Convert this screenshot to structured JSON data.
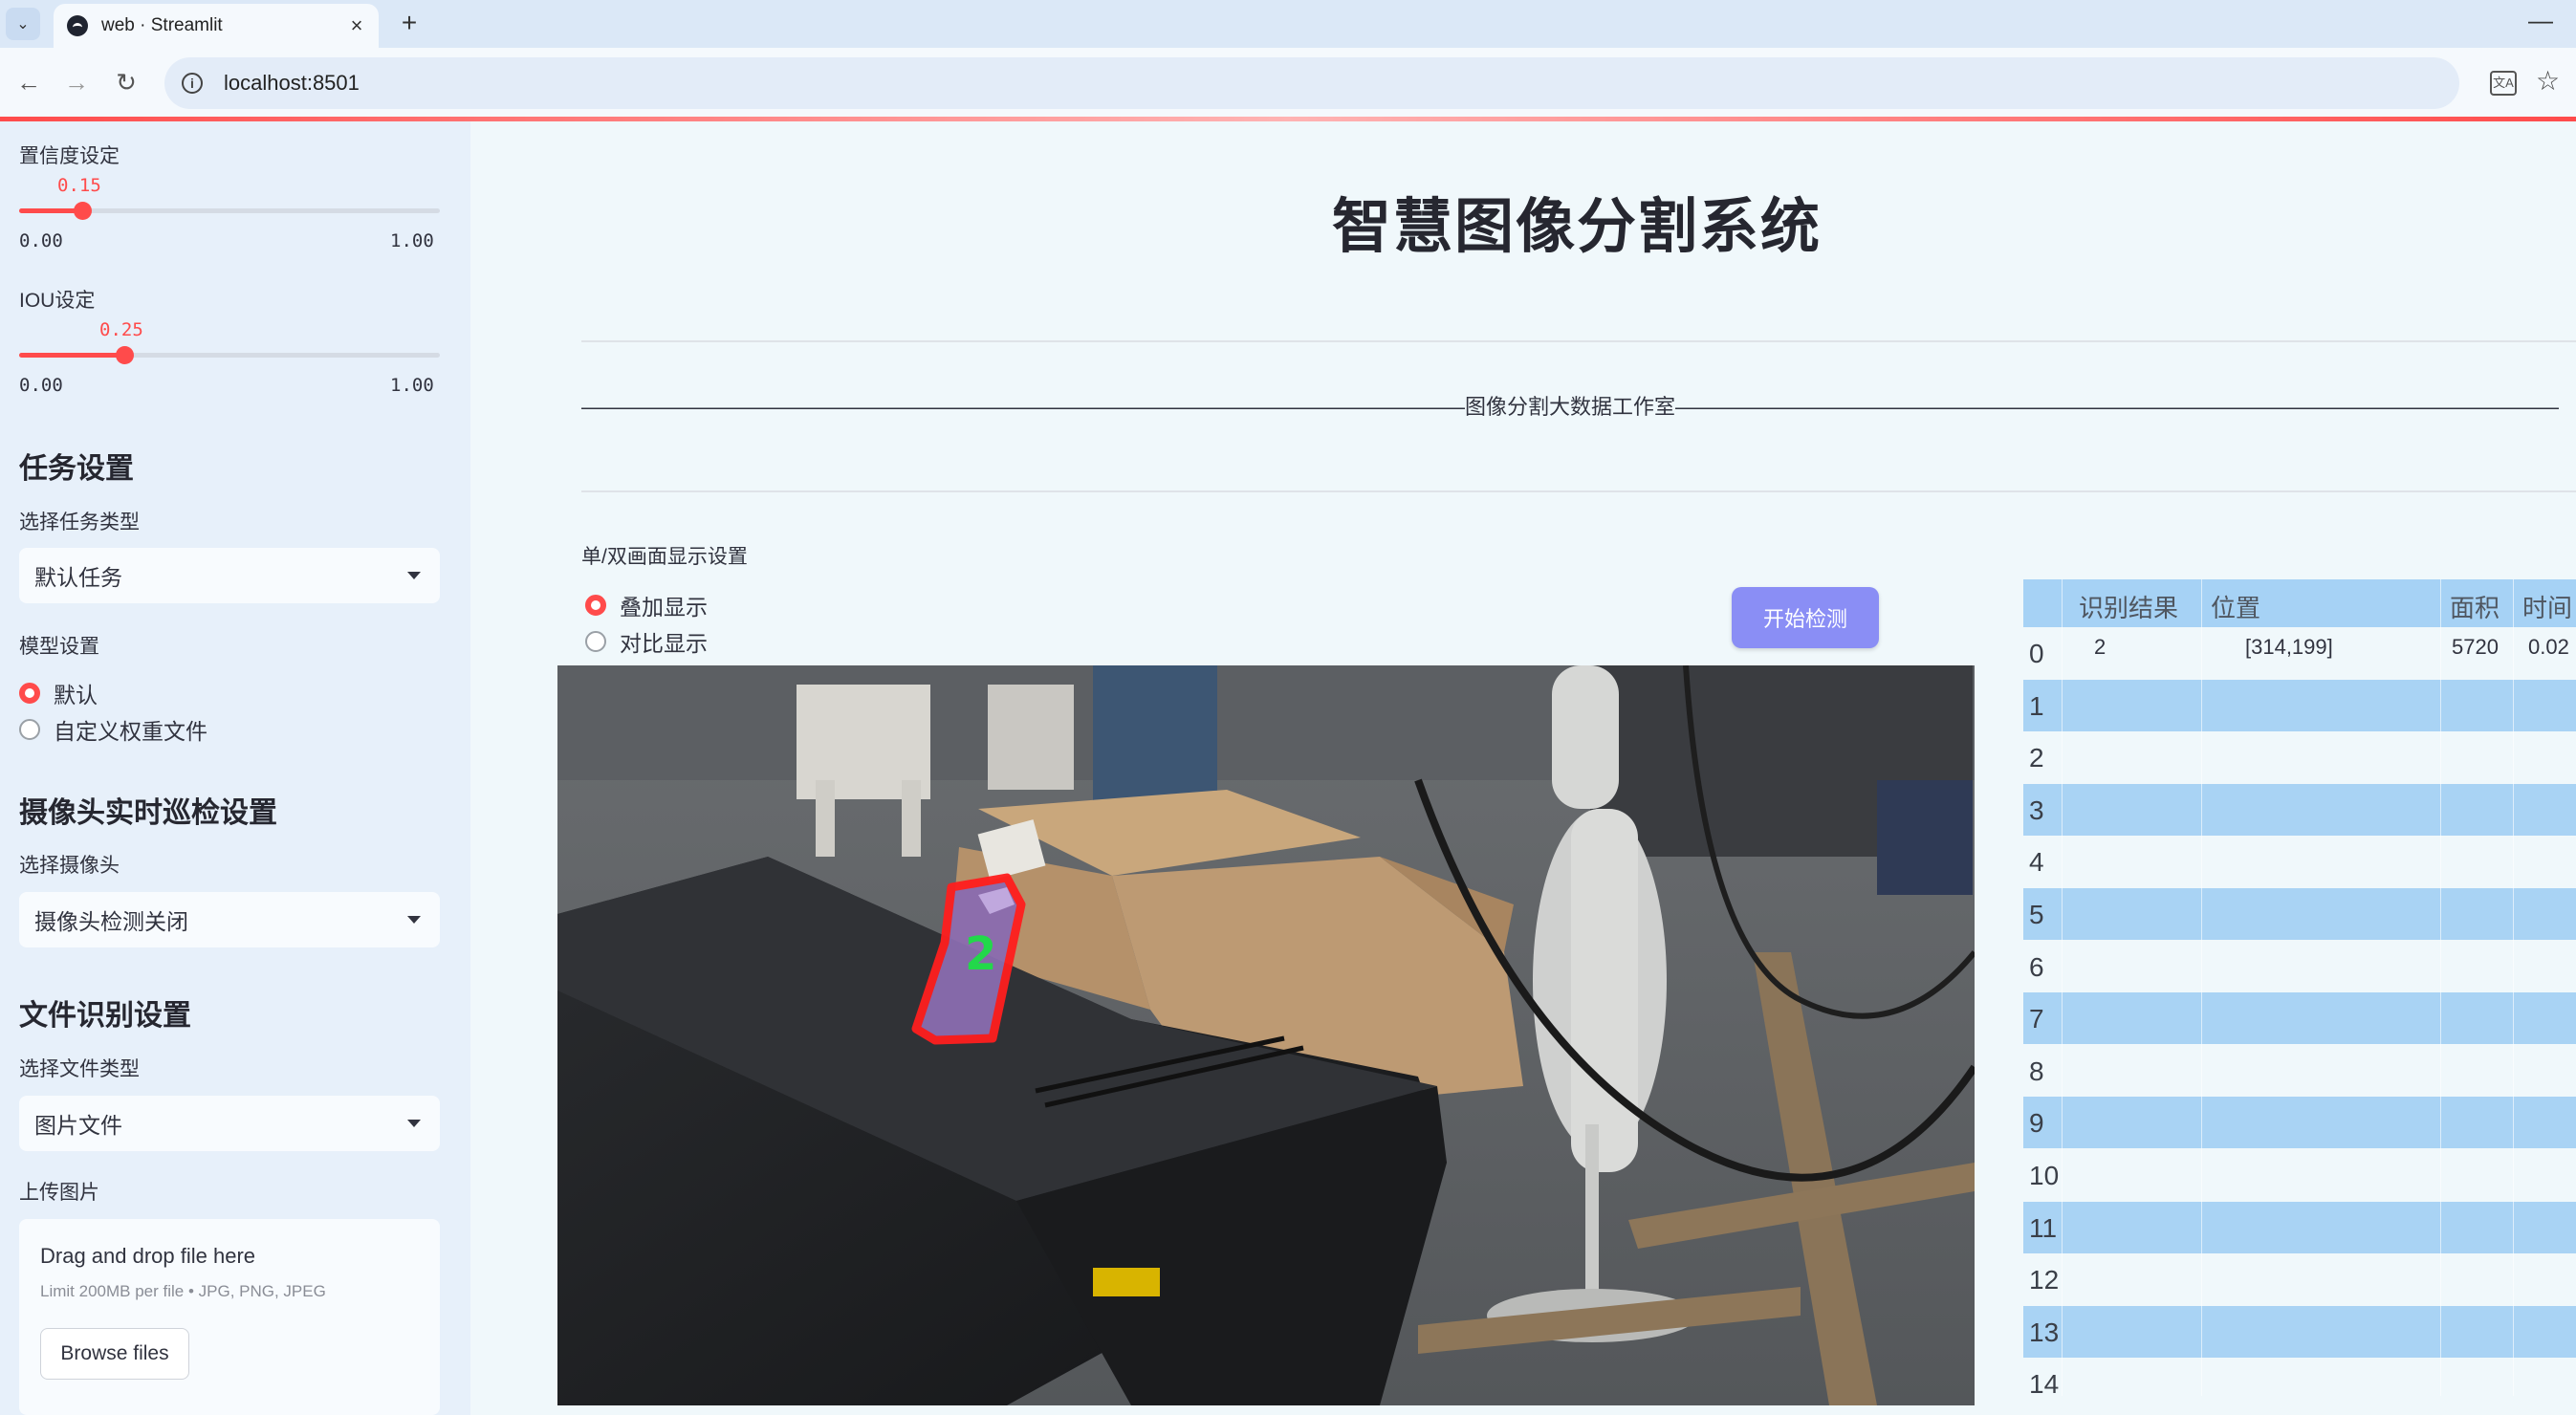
{
  "browser": {
    "tab_title": "web · Streamlit",
    "url": "localhost:8501",
    "new_tab": "+",
    "close_tab": "×",
    "minimize": "—"
  },
  "sidebar": {
    "confidence": {
      "label": "置信度设定",
      "value": "0.15",
      "value_fraction": 0.15,
      "min": "0.00",
      "max": "1.00"
    },
    "iou": {
      "label": "IOU设定",
      "value": "0.25",
      "value_fraction": 0.25,
      "min": "0.00",
      "max": "1.00"
    },
    "task_heading": "任务设置",
    "task_type_label": "选择任务类型",
    "task_type_value": "默认任务",
    "model_label": "模型设置",
    "model_options": [
      "默认",
      "自定义权重文件"
    ],
    "model_selected": 0,
    "camera_heading": "摄像头实时巡检设置",
    "camera_label": "选择摄像头",
    "camera_value": "摄像头检测关闭",
    "file_heading": "文件识别设置",
    "file_type_label": "选择文件类型",
    "file_type_value": "图片文件",
    "upload_label": "上传图片",
    "upload_title": "Drag and drop file here",
    "upload_limit": "Limit 200MB per file • JPG, PNG, JPEG",
    "browse_button": "Browse files"
  },
  "main": {
    "title": "智慧图像分割系统",
    "studio_line": "——————————————————————————————————————————图像分割大数据工作室——————————————————————————————————————————",
    "display_mode_label": "单/双画面显示设置",
    "display_options": [
      "叠加显示",
      "对比显示"
    ],
    "display_selected": 0,
    "start_button": "开始检测",
    "detection_label": "2"
  },
  "colors": {
    "accent": "#ff4b4b",
    "button": "#8a8ef5",
    "table_header": "#a6d2f5",
    "sidebar_bg": "#e7f0fa"
  },
  "table": {
    "columns": [
      "",
      "识别结果",
      "位置",
      "面积",
      "时间"
    ],
    "rows": [
      {
        "index": "0",
        "result": "2",
        "position": "[314,199]",
        "area": "5720",
        "time": "0.02"
      },
      {
        "index": "1"
      },
      {
        "index": "2"
      },
      {
        "index": "3"
      },
      {
        "index": "4"
      },
      {
        "index": "5"
      },
      {
        "index": "6"
      },
      {
        "index": "7"
      },
      {
        "index": "8"
      },
      {
        "index": "9"
      },
      {
        "index": "10"
      },
      {
        "index": "11"
      },
      {
        "index": "12"
      },
      {
        "index": "13"
      },
      {
        "index": "14"
      }
    ]
  }
}
